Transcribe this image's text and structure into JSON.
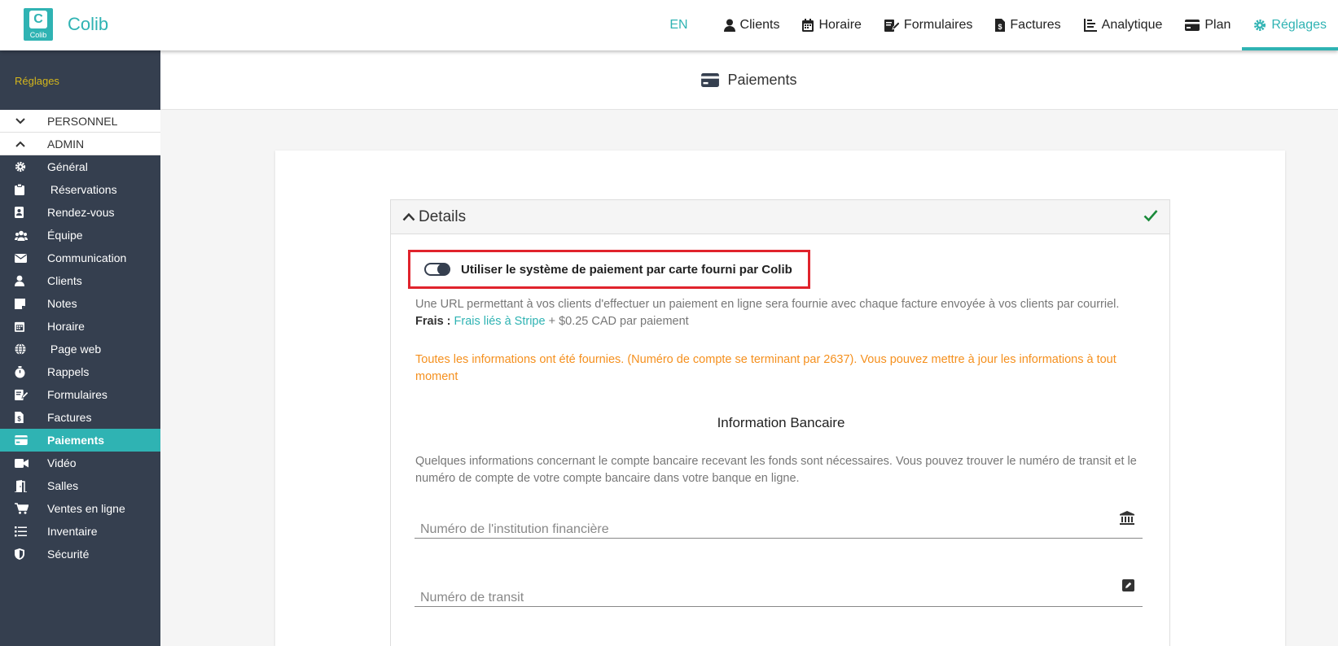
{
  "app": {
    "name": "Colib",
    "logo_text": "Colib"
  },
  "topnav": {
    "lang": "EN",
    "items": [
      {
        "label": "Clients",
        "icon": "user-icon"
      },
      {
        "label": "Horaire",
        "icon": "calendar-icon"
      },
      {
        "label": "Formulaires",
        "icon": "form-edit-icon"
      },
      {
        "label": "Factures",
        "icon": "invoice-icon"
      },
      {
        "label": "Analytique",
        "icon": "chart-icon"
      },
      {
        "label": "Plan",
        "icon": "credit-card-icon"
      },
      {
        "label": "Réglages",
        "icon": "gear-icon",
        "active": true
      }
    ]
  },
  "sidebar": {
    "header": "Réglages",
    "groups": [
      {
        "label": "PERSONNEL",
        "state": "collapsed"
      },
      {
        "label": "ADMIN",
        "state": "expanded"
      }
    ],
    "items": [
      {
        "label": "Général",
        "icon": "gear-icon"
      },
      {
        "label": " Réservations",
        "icon": "clipboard-icon"
      },
      {
        "label": "Rendez-vous",
        "icon": "contact-book-icon"
      },
      {
        "label": "Équipe",
        "icon": "users-icon"
      },
      {
        "label": "Communication",
        "icon": "envelope-icon"
      },
      {
        "label": "Clients",
        "icon": "user-icon"
      },
      {
        "label": "Notes",
        "icon": "note-icon"
      },
      {
        "label": "Horaire",
        "icon": "calendar-icon"
      },
      {
        "label": " Page web",
        "icon": "globe-icon"
      },
      {
        "label": "Rappels",
        "icon": "stopwatch-icon"
      },
      {
        "label": "Formulaires",
        "icon": "form-edit-icon"
      },
      {
        "label": "Factures",
        "icon": "invoice-icon"
      },
      {
        "label": "Paiements",
        "icon": "credit-card-icon",
        "active": true
      },
      {
        "label": "Vidéo",
        "icon": "video-icon"
      },
      {
        "label": "Salles",
        "icon": "door-icon"
      },
      {
        "label": "Ventes en ligne",
        "icon": "cart-icon"
      },
      {
        "label": "Inventaire",
        "icon": "list-icon"
      },
      {
        "label": "Sécurité",
        "icon": "shield-icon"
      }
    ]
  },
  "page": {
    "title": "Paiements",
    "panel": {
      "title": "Details",
      "toggle": {
        "label": "Utiliser le système de paiement par carte fourni par Colib",
        "checked": true
      },
      "description": "Une URL permettant à vos clients d'effectuer un paiement en ligne sera fournie avec chaque facture envoyée à vos clients par courriel.",
      "fees_label": "Frais :",
      "fees_link": "Frais liés à Stripe",
      "fees_rest": " + $0.25 CAD par paiement",
      "notice": "Toutes les informations ont été fournies. (Numéro de compte se terminant par 2637). Vous pouvez mettre à jour les informations à tout moment",
      "bank_section_title": "Information Bancaire",
      "bank_section_desc": "Quelques informations concernant le compte bancaire recevant les fonds sont nécessaires. Vous pouvez trouver le numéro de transit et le numéro de compte de votre compte bancaire dans votre banque en ligne.",
      "fields": [
        {
          "label": "Numéro de l'institution financière",
          "icon": "bank-icon"
        },
        {
          "label": "Numéro de transit",
          "icon": "edit-icon"
        }
      ]
    }
  },
  "colors": {
    "accent": "#2fb3b3",
    "sidebar": "#353f4f",
    "notice": "#f5901e",
    "highlight": "#e0232c",
    "check": "#1a8a3a"
  }
}
